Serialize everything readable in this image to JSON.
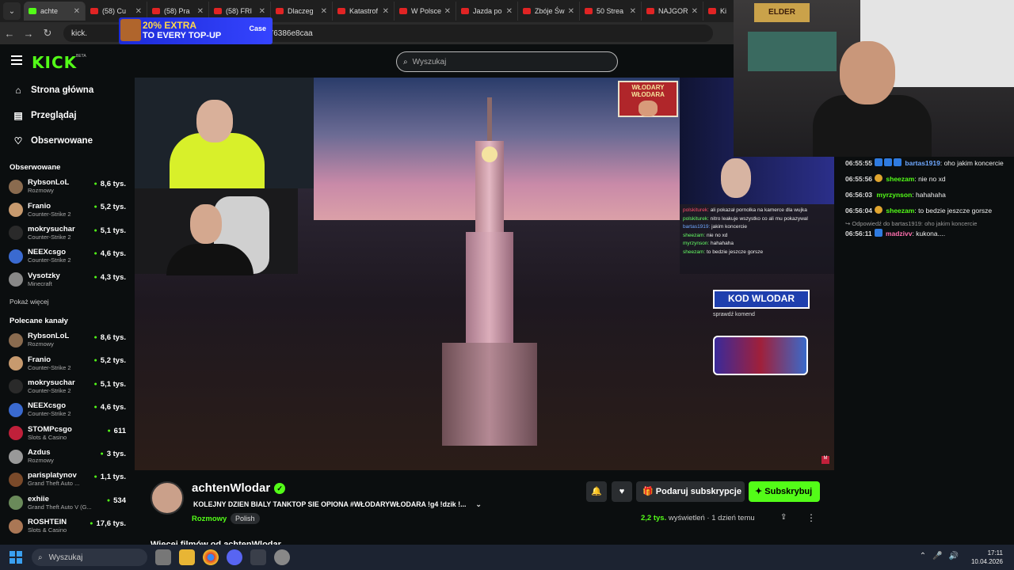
{
  "browser": {
    "tabs": [
      {
        "label": "achte",
        "active": true,
        "kick": true
      },
      {
        "label": "(58) Cu"
      },
      {
        "label": "(58) Pra"
      },
      {
        "label": "(58) FRI"
      },
      {
        "label": "Dlaczeg"
      },
      {
        "label": "Katastrof"
      },
      {
        "label": "W Polsce"
      },
      {
        "label": "Jazda po"
      },
      {
        "label": "Zbóje Św"
      },
      {
        "label": "50 Strea"
      },
      {
        "label": "NAJGOR"
      },
      {
        "label": "Ki"
      }
    ],
    "url_left": "kick.",
    "url_right": "-bf76386e8caa",
    "ad": {
      "line1_highlight": "20% EXTRA",
      "line2": "TO EVERY TOP-UP",
      "brand": "Case"
    }
  },
  "header": {
    "logo": "KICK",
    "beta": "BETA",
    "search_placeholder": "Wyszukaj"
  },
  "sidebar": {
    "nav": [
      {
        "icon": "home-icon",
        "glyph": "⌂",
        "label": "Strona główna"
      },
      {
        "icon": "browse-icon",
        "glyph": "▤",
        "label": "Przeglądaj"
      },
      {
        "icon": "heart-icon",
        "glyph": "♡",
        "label": "Obserwowane"
      }
    ],
    "followed_title": "Obserwowane",
    "followed": [
      {
        "name": "RybsonLoL",
        "category": "Rozmowy",
        "viewers": "8,6 tys.",
        "color": "#8a6b4f"
      },
      {
        "name": "Franio",
        "category": "Counter-Strike 2",
        "viewers": "5,2 tys.",
        "color": "#c79a6e"
      },
      {
        "name": "mokrysuchar",
        "category": "Counter-Strike 2",
        "viewers": "5,1 tys.",
        "color": "#2a2a2a"
      },
      {
        "name": "NEEXcsgo",
        "category": "Counter-Strike 2",
        "viewers": "4,6 tys.",
        "color": "#3a6ad0"
      },
      {
        "name": "Vysotzky",
        "category": "Minecraft",
        "viewers": "4,3 tys.",
        "color": "#888"
      }
    ],
    "show_more": "Pokaż więcej",
    "recommended_title": "Polecane kanały",
    "recommended": [
      {
        "name": "RybsonLoL",
        "category": "Rozmowy",
        "viewers": "8,6 tys.",
        "color": "#8a6b4f"
      },
      {
        "name": "Franio",
        "category": "Counter-Strike 2",
        "viewers": "5,2 tys.",
        "color": "#c79a6e"
      },
      {
        "name": "mokrysuchar",
        "category": "Counter-Strike 2",
        "viewers": "5,1 tys.",
        "color": "#2a2a2a"
      },
      {
        "name": "NEEXcsgo",
        "category": "Counter-Strike 2",
        "viewers": "4,6 tys.",
        "color": "#3a6ad0"
      },
      {
        "name": "STOMPcsgo",
        "category": "Slots & Casino",
        "viewers": "611",
        "color": "#c0203a"
      },
      {
        "name": "Azdus",
        "category": "Rozmowy",
        "viewers": "3 tys.",
        "color": "#999"
      },
      {
        "name": "parisplatynov",
        "category": "Grand Theft Auto ...",
        "viewers": "1,1 tys.",
        "color": "#7a4a2a"
      },
      {
        "name": "exhiie",
        "category": "Grand Theft Auto V (G...",
        "viewers": "534",
        "color": "#6a8a5a"
      },
      {
        "name": "ROSHTEIN",
        "category": "Slots & Casino",
        "viewers": "17,6 tys.",
        "color": "#aa7755"
      }
    ]
  },
  "video": {
    "logo_text": "WŁODARY WŁODARA",
    "overlay_chat": [
      {
        "user": "polskiturek:",
        "text": " nitro leakuje wszystko co ali mu pokazywal",
        "cls": "u2"
      },
      {
        "user": "bartas1919:",
        "text": " jakim koncercie",
        "cls": "u3"
      },
      {
        "user": "sheezam:",
        "text": " nie no xd",
        "cls": "u2"
      },
      {
        "user": "myrzynson:",
        "text": " hahahaha",
        "cls": "u2"
      },
      {
        "user": "sheezam:",
        "text": " to bedzie jeszcze gorsze",
        "cls": "u2"
      }
    ],
    "overlay_first": "ali pokazał pornolka na kamerce dla wujka",
    "kod": "KOD WLODAR",
    "sprawdz": "sprawdź komend"
  },
  "stream": {
    "channel": "achtenWlodar",
    "title": "KOLEJNY DZIEN BIALY TANKTOP SIE OPIONA  #WŁODARYWŁODARA  !g4 !dzik !...",
    "category": "Rozmowy",
    "language": "Polish",
    "gift_label": "Podaruj subskrypcje",
    "subscribe_label": "Subskrybuj",
    "views_count": "2,2 tys.",
    "views_label": "wyświetleń",
    "time_ago": "1 dzień temu",
    "more_videos": "Więcej filmów od achtenWlodar"
  },
  "chat": [
    {
      "time": "06:55:55",
      "user": "bartas1919",
      "color": "#6fa8ff",
      "text": "oho jakim koncercie",
      "badges": 3
    },
    {
      "time": "06:55:56",
      "user": "sheezam",
      "color": "#53fc18",
      "text": "nie no xd",
      "badges": 1,
      "gold": true
    },
    {
      "time": "06:56:03",
      "user": "myrzynson",
      "color": "#53fc18",
      "text": "hahahaha",
      "badges": 0
    },
    {
      "time": "06:56:04",
      "user": "sheezam",
      "color": "#53fc18",
      "text": "to bedzie jeszcze gorsze",
      "badges": 1,
      "gold": true
    }
  ],
  "chat_reply": {
    "label": "Odpowiedź do bartas1919: oho jakim koncercie",
    "time": "06:56:11",
    "user": "madzivv",
    "color": "#ff6fae",
    "text": "kukona...."
  },
  "webcam_sign": "ELDER",
  "taskbar": {
    "search_placeholder": "Wyszukaj",
    "time": "17:11",
    "date": "10.04.2026"
  }
}
